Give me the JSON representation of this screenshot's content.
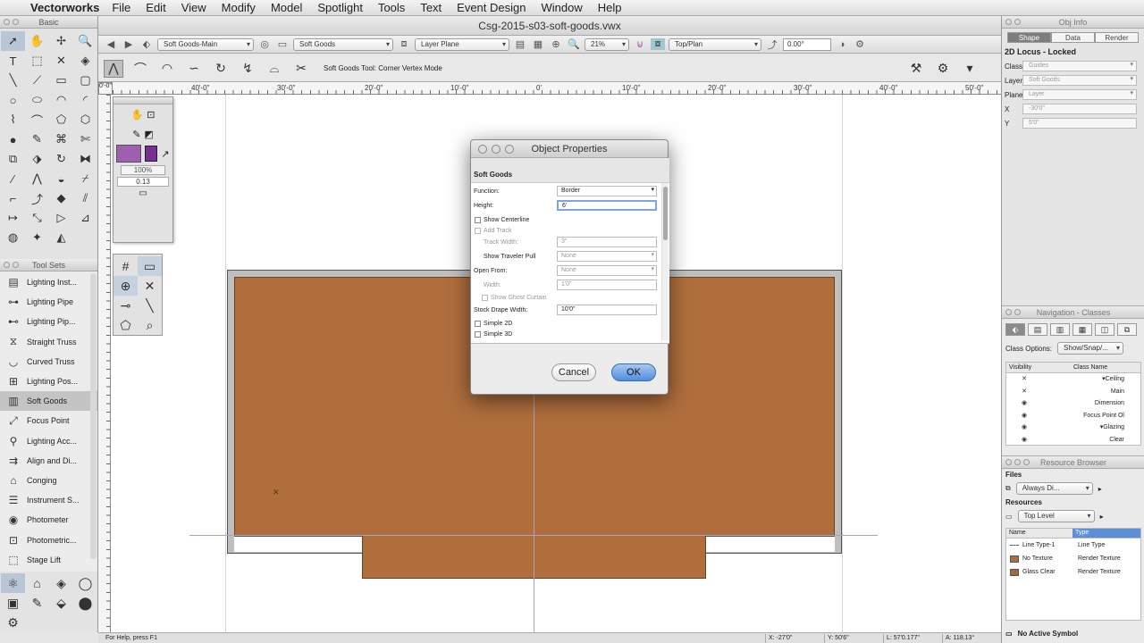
{
  "menubar": {
    "app_name": "Vectorworks",
    "menus": [
      "File",
      "Edit",
      "View",
      "Modify",
      "Model",
      "Spotlight",
      "Tools",
      "Text",
      "Event Design",
      "Window",
      "Help"
    ]
  },
  "window": {
    "title": "Csg-2015-s03-soft-goods.vwx"
  },
  "palettes": {
    "basic_title": "Basic",
    "toolsets_title": "Tool Sets",
    "toolsets": [
      "Lighting Inst...",
      "Lighting Pipe",
      "Lighting Pip...",
      "Straight Truss",
      "Curved Truss",
      "Lighting Pos...",
      "Soft Goods",
      "Focus Point",
      "Lighting Acc...",
      "Align and Di...",
      "Conging",
      "Instrument S...",
      "Photometer",
      "Photometric...",
      "Stage Lift"
    ],
    "selected_toolset": "Soft Goods"
  },
  "viewbar": {
    "class": "Soft Goods-Main",
    "layer": "Soft Goods",
    "layer_plane": "Layer Plane",
    "zoom": "21%",
    "view": "Top/Plan",
    "rotation": "0.00°"
  },
  "modebar": {
    "label": "Soft Goods Tool: Corner Vertex Mode"
  },
  "ruler": {
    "corner": "0'-0\"",
    "ticks": [
      "40'-0\"",
      "30'-0\"",
      "20'-0\"",
      "10'-0\"",
      "0'",
      "10'-0\"",
      "20'-0\"",
      "30'-0\"",
      "40'-0\"",
      "50'-0\""
    ]
  },
  "attributes": {
    "opacity": "100%",
    "thickness": "0.13",
    "fill_color": "#9f5fb0",
    "pen_color": "#7a2e92"
  },
  "dialog": {
    "title": "Object Properties",
    "section": "Soft Goods",
    "fields": {
      "function_label": "Function:",
      "function_value": "Border",
      "height_label": "Height:",
      "height_value": "6'",
      "show_centerline": "Show Centerline",
      "add_track": "Add Track",
      "track_width_label": "Track Width:",
      "track_width_value": "3\"",
      "show_traveler_label": "Show Traveler Pull",
      "show_traveler_value": "None",
      "open_from_label": "Open From:",
      "open_from_value": "None",
      "width_label": "Width:",
      "width_value": "1'0\"",
      "show_ghost": "Show Ghost Curtain",
      "stock_label": "Stock Drape Width:",
      "stock_value": "10'0\"",
      "simple_2d": "Simple 2D",
      "simple_3d": "Simple 3D"
    },
    "cancel_label": "Cancel",
    "ok_label": "OK"
  },
  "obj_info": {
    "title": "Obj Info",
    "tabs": [
      "Shape",
      "Data",
      "Render"
    ],
    "heading": "2D Locus - Locked",
    "class_label": "Class",
    "class_value": "Guides",
    "layer_label": "Layer",
    "layer_value": "Soft Goods",
    "plane_label": "Plane",
    "plane_value": "Layer",
    "x_label": "X",
    "x_value": "-30'0\"",
    "y_label": "Y",
    "y_value": "5'0\""
  },
  "navigation": {
    "title": "Navigation - Classes",
    "class_options_label": "Class Options:",
    "class_options_value": "Show/Snap/...",
    "col_visibility": "Visibility",
    "col_class_name": "Class Name",
    "rows": [
      {
        "vis": "✕",
        "name": "▾Ceiling"
      },
      {
        "vis": "✕",
        "name": "Main"
      },
      {
        "vis": "◉",
        "name": "Dimension"
      },
      {
        "vis": "◉",
        "name": "Focus Point Ol"
      },
      {
        "vis": "◉",
        "name": "▾Glazing"
      },
      {
        "vis": "◉",
        "name": "Clear"
      }
    ]
  },
  "resources": {
    "title": "Resource Browser",
    "files_label": "Files",
    "files_value": "Always Di...",
    "resources_label": "Resources",
    "resources_value": "Top Level",
    "col_name": "Name",
    "col_type": "Type",
    "items": [
      {
        "name": "Line Type-1",
        "type": "Line Type",
        "color": "#ffffff"
      },
      {
        "name": "No Texture",
        "type": "Render Texture",
        "color": "#b06e3d"
      },
      {
        "name": "Glass Clear",
        "type": "Render Texture",
        "color": "#a8643a"
      }
    ],
    "active_symbol": "No Active Symbol"
  },
  "status": {
    "help": "For Help, press F1",
    "x": "X: -27'0\"",
    "y": "Y: 50'6\"",
    "l": "L: 57'0.177\"",
    "a": "A: 118.13°"
  }
}
